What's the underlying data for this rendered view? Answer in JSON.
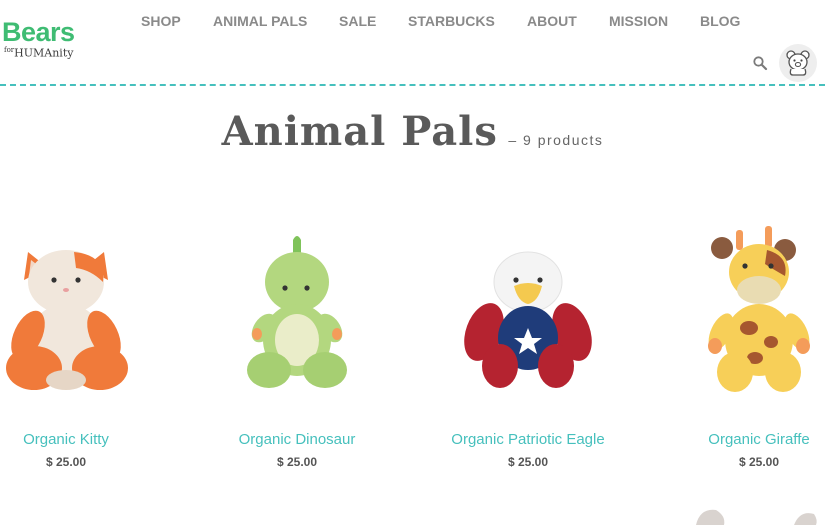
{
  "logo": {
    "main_accent": "Bears",
    "sub_for": "for",
    "sub_main": "HUMAnity"
  },
  "nav": {
    "items": [
      {
        "label": "SHOP"
      },
      {
        "label": "ANIMAL PALS"
      },
      {
        "label": "SALE"
      },
      {
        "label": "STARBUCKS"
      },
      {
        "label": "ABOUT"
      },
      {
        "label": "MISSION"
      },
      {
        "label": "BLOG"
      }
    ]
  },
  "header": {
    "search_icon": "search-icon",
    "account_icon": "bear-face-icon"
  },
  "page": {
    "title": "Animal Pals",
    "count": "– 9 products"
  },
  "products": [
    {
      "name": "Organic Kitty",
      "price": "$ 25.00",
      "image": "orange-white-plush-kitty"
    },
    {
      "name": "Organic Dinosaur",
      "price": "$ 25.00",
      "image": "green-plush-dinosaur"
    },
    {
      "name": "Organic Patriotic Eagle",
      "price": "$ 25.00",
      "image": "white-blue-red-plush-eagle"
    },
    {
      "name": "Organic Giraffe",
      "price": "$ 25.00",
      "image": "yellow-plush-giraffe"
    }
  ],
  "colors": {
    "accent_teal": "#46c0bd",
    "logo_green": "#3fbc73",
    "nav_text": "#8a8a8a",
    "title_text": "#5a5a5a"
  }
}
